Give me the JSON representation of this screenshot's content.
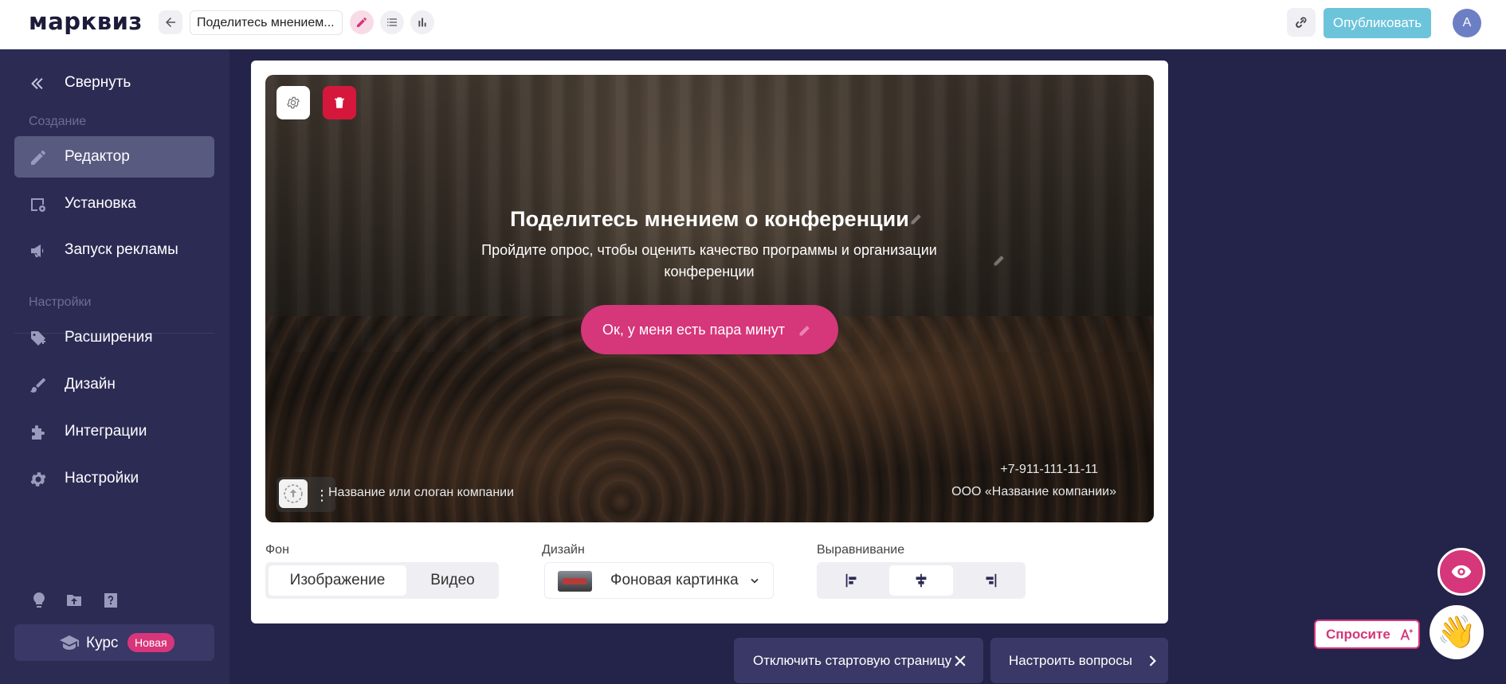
{
  "app": {
    "logo": "марквиз"
  },
  "topbar": {
    "quiz_title": "Поделитесь мнением...",
    "publish_label": "Опубликовать",
    "avatar_initial": "A"
  },
  "sidebar": {
    "collapse_label": "Свернуть",
    "section_create": "Создание",
    "section_settings": "Настройки",
    "items": [
      {
        "label": "Редактор",
        "icon": "pencil-icon",
        "active": true
      },
      {
        "label": "Установка",
        "icon": "install-icon"
      },
      {
        "label": "Запуск рекламы",
        "icon": "megaphone-icon"
      },
      {
        "label": "Расширения",
        "icon": "tag-plus-icon"
      },
      {
        "label": "Дизайн",
        "icon": "brush-icon"
      },
      {
        "label": "Интеграции",
        "icon": "puzzle-icon"
      },
      {
        "label": "Настройки",
        "icon": "gear-icon"
      }
    ],
    "course_label": "Курс",
    "course_badge": "Новая"
  },
  "hero": {
    "title": "Поделитесь мнением о конференции",
    "subtitle": "Пройдите опрос, чтобы оценить качество программы и организации конференции",
    "cta_label": "Ок, у меня есть пара минут",
    "slogan": "Название или слоган компании",
    "phone": "+7-911-111-11-11",
    "company": "ООО «Название компании»"
  },
  "controls": {
    "background_label": "Фон",
    "background_options": [
      "Изображение",
      "Видео"
    ],
    "background_selected": "Изображение",
    "design_label": "Дизайн",
    "design_value": "Фоновая картинка",
    "align_label": "Выравнивание",
    "align_selected": "center"
  },
  "actions": {
    "disable_start": "Отключить стартовую страницу",
    "setup_questions": "Настроить вопросы"
  },
  "floating": {
    "ask_label": "Спросите",
    "wave_emoji": "👋"
  },
  "colors": {
    "accent": "#d6367a",
    "publish": "#6cc4db",
    "sidebar": "#2c2b54",
    "background": "#24234a",
    "delete": "#d6173c"
  }
}
